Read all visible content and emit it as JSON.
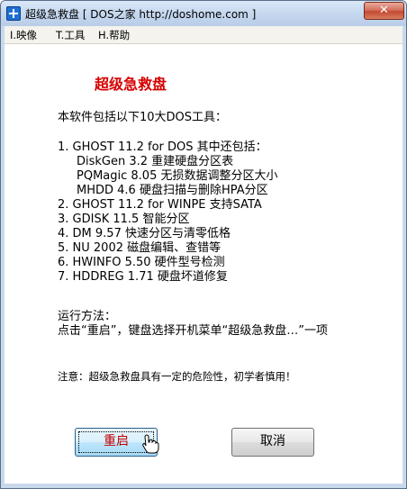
{
  "window": {
    "title": "超级急救盘 [ DOS之家 http://doshome.com ]",
    "close_glyph": "✕"
  },
  "menu": [
    {
      "label": "I.映像"
    },
    {
      "label": "T.工具"
    },
    {
      "label": "H.帮助"
    }
  ],
  "content": {
    "heading": "超级急救盘",
    "intro": "本软件包括以下10大DOS工具：",
    "tools": [
      "1. GHOST 11.2 for DOS 其中还包括：",
      "DiskGen 3.2  重建硬盘分区表",
      "PQMagic 8.05 无损数据调整分区大小",
      "MHDD 4.6 硬盘扫描与删除HPA分区",
      "2. GHOST 11.2 for WINPE  支持SATA",
      "3. GDISK 11.5 智能分区",
      "4. DM 9.57 快速分区与清零低格",
      "5. NU 2002 磁盘编辑、查错等",
      "6. HWINFO 5.50 硬件型号检测",
      "7. HDDREG 1.71 硬盘坏道修复"
    ],
    "usage_title": "运行方法：",
    "usage_text": "点击“重启”，键盘选择开机菜单“超级急救盘…”一项",
    "warning": "注意：超级急救盘具有一定的危险性，初学者慎用！"
  },
  "buttons": {
    "restart": "重启",
    "cancel": "取消"
  },
  "colors": {
    "heading": "#d60000",
    "restart_text": "#c00000",
    "titlebar": "#c6d8ef"
  },
  "icons": {
    "app": "app-plus-icon",
    "close": "close-icon",
    "cursor": "hand-pointer-icon"
  }
}
